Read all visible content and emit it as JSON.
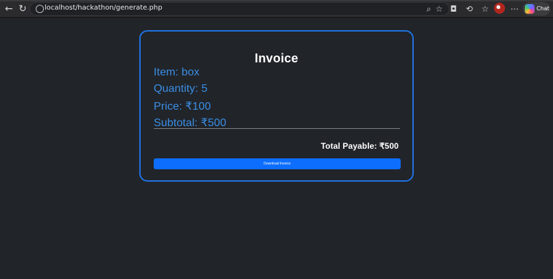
{
  "browser": {
    "url": "localhost/hackathon/generate.php",
    "chat_label": "Chat"
  },
  "invoice": {
    "title": "Invoice",
    "item_line": "Item: box",
    "quantity_line": "Quantity: 5",
    "price_line": "Price: ₹100",
    "subtotal_line": "Subtotal: ₹500",
    "total_line": "Total Payable: ₹500",
    "download_label": "Download Invoice"
  },
  "icons": {
    "back": "back-arrow-icon",
    "refresh": "refresh-icon",
    "site_info": "site-info-icon",
    "zoom": "zoom-icon",
    "favorite": "favorite-star-icon",
    "screenshot": "camera-icon",
    "extension": "extension-icon",
    "favorites": "favorites-icon",
    "more": "more-options-icon",
    "chat": "copilot-icon"
  },
  "colors": {
    "page_background": "#212429",
    "card_border": "#1f74e8",
    "detail_text": "#3b8fe7",
    "button_background": "#0d6efd"
  }
}
